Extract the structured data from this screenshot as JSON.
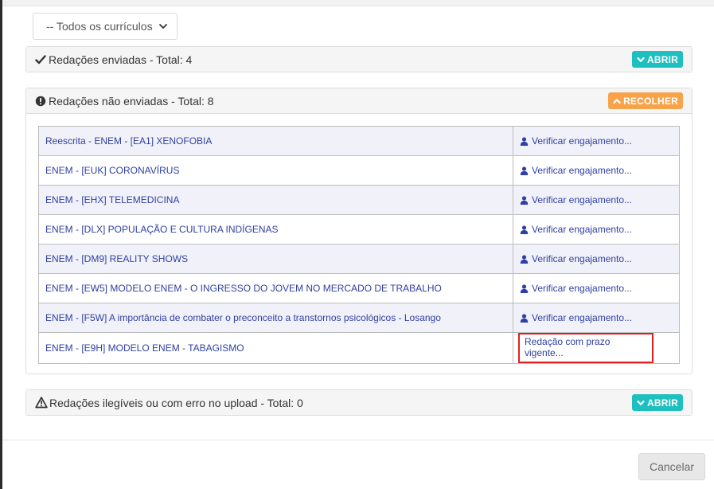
{
  "filter": {
    "selected": "-- Todos os currículos"
  },
  "panels": {
    "sent": {
      "title": "Redações enviadas - Total: 4",
      "toggle_label": "ABRIR"
    },
    "not_sent": {
      "title": "Redações não enviadas - Total: 8",
      "toggle_label": "RECOLHER"
    },
    "illegible": {
      "title": "Redações ilegíveis ou com erro no upload - Total: 0",
      "toggle_label": "ABRIR"
    }
  },
  "essays": [
    {
      "name": "Reescrita - ENEM - [EA1] XENOFOBIA",
      "action": "Verificar engajamento..."
    },
    {
      "name": "ENEM - [EUK] CORONAVÍRUS",
      "action": "Verificar engajamento..."
    },
    {
      "name": "ENEM - [EHX] TELEMEDICINA",
      "action": "Verificar engajamento..."
    },
    {
      "name": "ENEM - [DLX] POPULAÇÃO E CULTURA INDÍGENAS",
      "action": "Verificar engajamento..."
    },
    {
      "name": "ENEM - [DM9] REALITY SHOWS",
      "action": "Verificar engajamento..."
    },
    {
      "name": "ENEM - [EW5] MODELO ENEM - O INGRESSO DO JOVEM NO MERCADO DE TRABALHO",
      "action": "Verificar engajamento..."
    },
    {
      "name": "ENEM - [F5W] A importância de combater o preconceito a transtornos psicológicos - Losango",
      "action": "Verificar engajamento..."
    },
    {
      "name": "ENEM - [E9H] MODELO ENEM - TABAGISMO",
      "action": "Redação com prazo vigente..."
    }
  ],
  "footer": {
    "cancel_label": "Cancelar"
  },
  "colors": {
    "teal": "#1ebfbf",
    "orange": "#f7a34a",
    "link": "#2f3fa3",
    "highlight": "#e02020"
  },
  "icons": {
    "sent": "check-icon",
    "not_sent": "exclamation-circle-icon",
    "illegible": "warning-triangle-icon",
    "engage": "user-icon"
  }
}
